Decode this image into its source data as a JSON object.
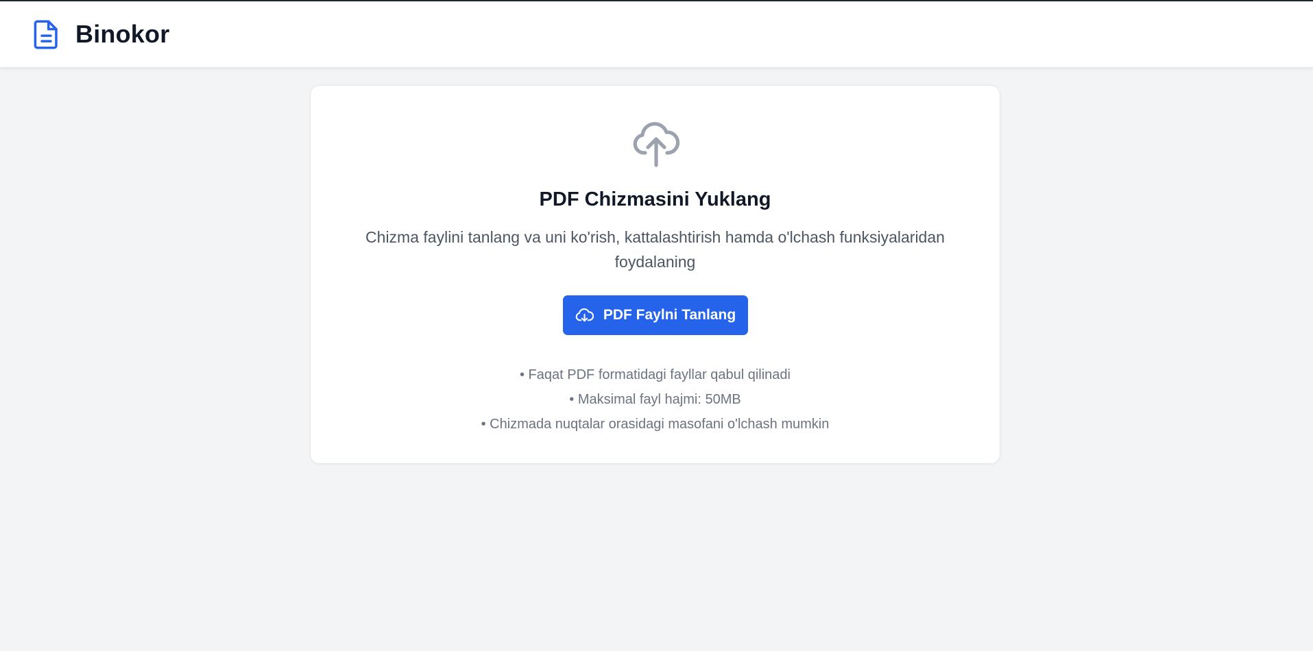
{
  "header": {
    "brand": "Binokor",
    "logo_icon": "file-text-icon",
    "accent_color": "#2563eb"
  },
  "upload": {
    "icon": "cloud-upload-icon",
    "title": "PDF Chizmasini Yuklang",
    "description": "Chizma faylini tanlang va uni ko'rish, kattalashtirish hamda o'lchash funksiyalaridan foydalaning",
    "button_label": "PDF Faylni Tanlang",
    "button_icon": "cloud-download-icon",
    "notes": [
      "• Faqat PDF formatidagi fayllar qabul qilinadi",
      "• Maksimal fayl hajmi: 50MB",
      "• Chizmada nuqtalar orasidagi masofani o'lchash mumkin"
    ]
  }
}
